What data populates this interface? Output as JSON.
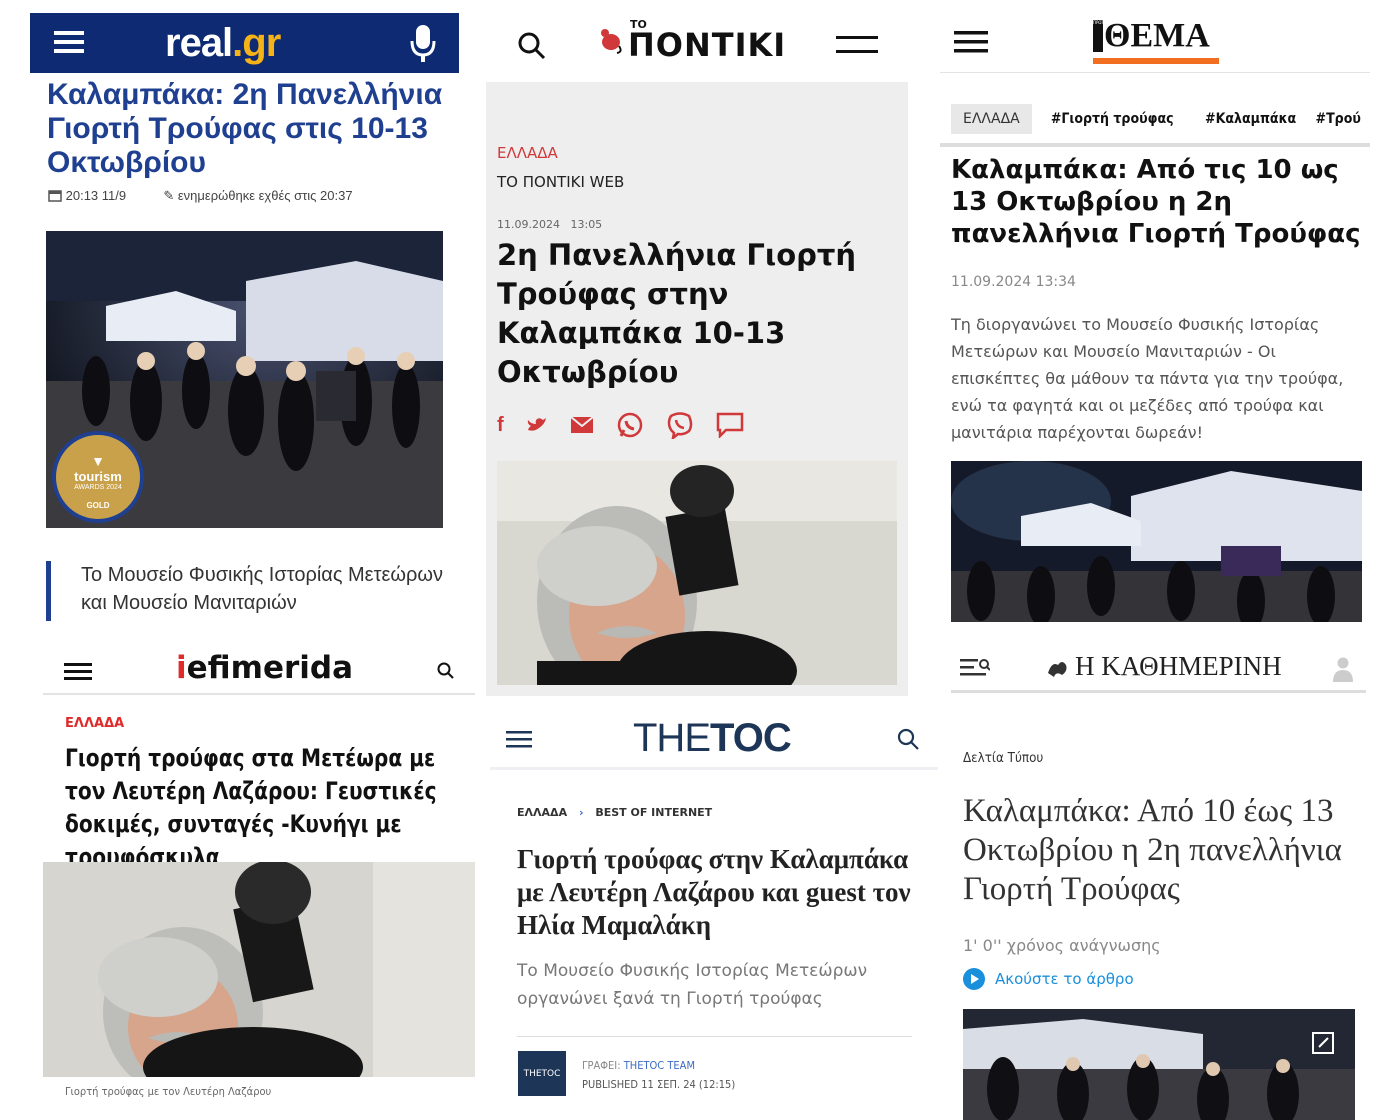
{
  "realgr": {
    "logo_main": "real",
    "logo_suffix": ".gr",
    "title": "Καλαμπάκα: 2η Πανελλήνια Γιορτή Τρούφας στις 10-13 Οκτωβρίου",
    "date": "20:13 11/9",
    "updated": "ενημερώθηκε εχθές στις 20:37",
    "badge_line1": "tourism",
    "badge_line2": "AWARDS 2024",
    "badge_line3": "GOLD",
    "teaser": "Το Μουσείο Φυσικής Ιστορίας Μετεώρων και Μουσείο Μανιταριών",
    "colors": {
      "bar": "#0d2a73",
      "accent": "#f6b317",
      "title": "#1f3f90"
    }
  },
  "pontiki": {
    "logo_to": "ΤΟ",
    "logo": "ΠΟΝΤΙΚΙ",
    "category": "ΕΛΛΑΔΑ",
    "source": "ΤΟ ΠΟΝΤΙΚΙ WEB",
    "date": "11.09.2024",
    "time": "13:05",
    "title": "2η Πανελλήνια Γιορτή Τρούφας στην Καλαμπάκα 10-13 Οκτωβρίου",
    "share_icons": [
      "facebook-icon",
      "twitter-icon",
      "mail-icon",
      "whatsapp-icon",
      "viber-icon",
      "comment-icon"
    ]
  },
  "iefimerida": {
    "logo_i": "i",
    "logo_rest": "efimerida",
    "category": "ΕΛΛΑΔΑ",
    "title": "Γιορτή τρούφας στα Μετέωρα με τον Λευτέρη Λαζάρου: Γευστικές δοκιμές, συνταγές -Κυνήγι με τρουφόσκυλα",
    "caption": "Γιορτή τρούφας με τον Λευτέρη Λαζάρου"
  },
  "thetoc": {
    "logo_a": "THE",
    "logo_b": "TOC",
    "breadcrumb_1": "ΕΛΛΑΔΑ",
    "breadcrumb_2": "BEST OF INTERNET",
    "title": "Γιορτή τρούφας στην Καλαμπάκα με Λευτέρη Λαζάρου και guest τον Ηλία Μαμαλάκη",
    "summary": "Το Μουσείο Φυσικής Ιστορίας Μετεώρων οργανώνει ξανά τη Γιορτή τρούφας",
    "avatar_text": "THETOC",
    "author_label": "ΓΡΑΦΕΙ:",
    "author": "THETOC TEAM",
    "published": "PUBLISHED 11 ΣΕΠ. 24 (12:15)"
  },
  "protothema": {
    "logo": "ΘΕΜΑ",
    "logo_prefix": "ΠΡΩΤΟ",
    "tags": [
      "ΕΛΛΑΔΑ",
      "#Γιορτή τρούφας",
      "#Καλαμπάκα",
      "#Τρού"
    ],
    "title": "Καλαμπάκα: Από τις 10 ως 13 Οκτωβρίου η 2η πανελλήνια Γιορτή Τρούφας",
    "date": "11.09.2024 13:34",
    "summary": "Τη διοργανώνει το Μουσείο Φυσικής Ιστορίας Μετεώρων και Μουσείο Μανιταριών - Οι επισκέπτες θα μάθουν τα πάντα για την τρούφα, ενώ τα φαγητά και οι μεζέδες από τρούφα και μανιτάρια παρέχονται δωρεάν!"
  },
  "kathimerini": {
    "logo": "Η ΚΑΘΗΜΕΡΙΝΗ",
    "section": "Δελτία Τύπου",
    "title": "Καλαμπάκα: Από 10 έως 13 Οκτωβρίου η 2η πανελλήνια Γιορτή Τρούφας",
    "read_time": "1' 0'' χρόνος ανάγνωσης",
    "listen": "Ακούστε το άρθρο"
  }
}
